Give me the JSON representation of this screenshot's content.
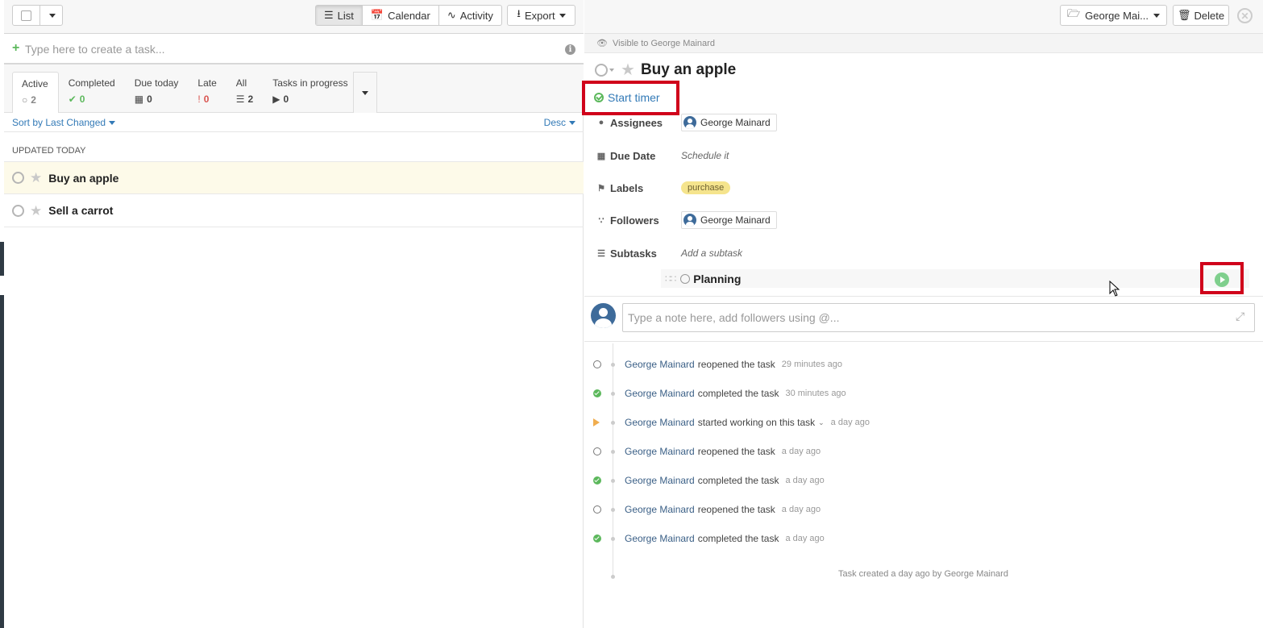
{
  "toolbar": {
    "views": [
      {
        "label": "List",
        "icon": "list-icon",
        "active": true
      },
      {
        "label": "Calendar",
        "icon": "calendar-icon",
        "active": false
      },
      {
        "label": "Activity",
        "icon": "activity-icon",
        "active": false
      }
    ],
    "export_label": "Export"
  },
  "create": {
    "placeholder": "Type here to create a task..."
  },
  "filters": [
    {
      "label": "Active",
      "count": "2",
      "icon": "circle-icon",
      "color": "#888888"
    },
    {
      "label": "Completed",
      "count": "0",
      "icon": "check-icon",
      "color": "#5cb85c"
    },
    {
      "label": "Due today",
      "count": "0",
      "icon": "calendar-icon",
      "color": "#444444"
    },
    {
      "label": "Late",
      "count": "0",
      "icon": "exclamation-icon",
      "color": "#d9534f"
    },
    {
      "label": "All",
      "count": "2",
      "icon": "list-icon",
      "color": "#444444"
    },
    {
      "label": "Tasks in progress",
      "count": "0",
      "icon": "play-icon",
      "color": "#444444"
    }
  ],
  "sort": {
    "label": "Sort by Last Changed",
    "order": "Desc"
  },
  "list": {
    "group_heading": "UPDATED TODAY",
    "tasks": [
      {
        "title": "Buy an apple",
        "selected": true
      },
      {
        "title": "Sell a carrot",
        "selected": false
      }
    ]
  },
  "detail": {
    "project_label": "George Mai...",
    "delete_label": "Delete",
    "visibility": "Visible to George Mainard",
    "title": "Buy an apple",
    "timer_label": "Start timer",
    "props": {
      "assignees_label": "Assignees",
      "assignee": "George Mainard",
      "due_label": "Due Date",
      "due_value": "Schedule it",
      "labels_label": "Labels",
      "label_value": "purchase",
      "followers_label": "Followers",
      "follower": "George Mainard",
      "subtasks_label": "Subtasks",
      "subtask_placeholder": "Add a subtask"
    },
    "subtask": {
      "title": "Planning"
    },
    "note_placeholder": "Type a note here, add followers using @...",
    "activity": [
      {
        "user": "George Mainard",
        "action": "reopened the task",
        "time": "29 minutes ago",
        "icon": "open"
      },
      {
        "user": "George Mainard",
        "action": "completed the task",
        "time": "30 minutes ago",
        "icon": "done"
      },
      {
        "user": "George Mainard",
        "action": "started working on this task",
        "time": "a day ago",
        "icon": "work"
      },
      {
        "user": "George Mainard",
        "action": "reopened the task",
        "time": "a day ago",
        "icon": "open"
      },
      {
        "user": "George Mainard",
        "action": "completed the task",
        "time": "a day ago",
        "icon": "done"
      },
      {
        "user": "George Mainard",
        "action": "reopened the task",
        "time": "a day ago",
        "icon": "open"
      },
      {
        "user": "George Mainard",
        "action": "completed the task",
        "time": "a day ago",
        "icon": "done"
      }
    ],
    "created_note": "Task created a day ago by George Mainard"
  },
  "colors": {
    "accent": "#337ab7",
    "highlight": "#d0021b",
    "selected_row": "#fdfae9"
  }
}
